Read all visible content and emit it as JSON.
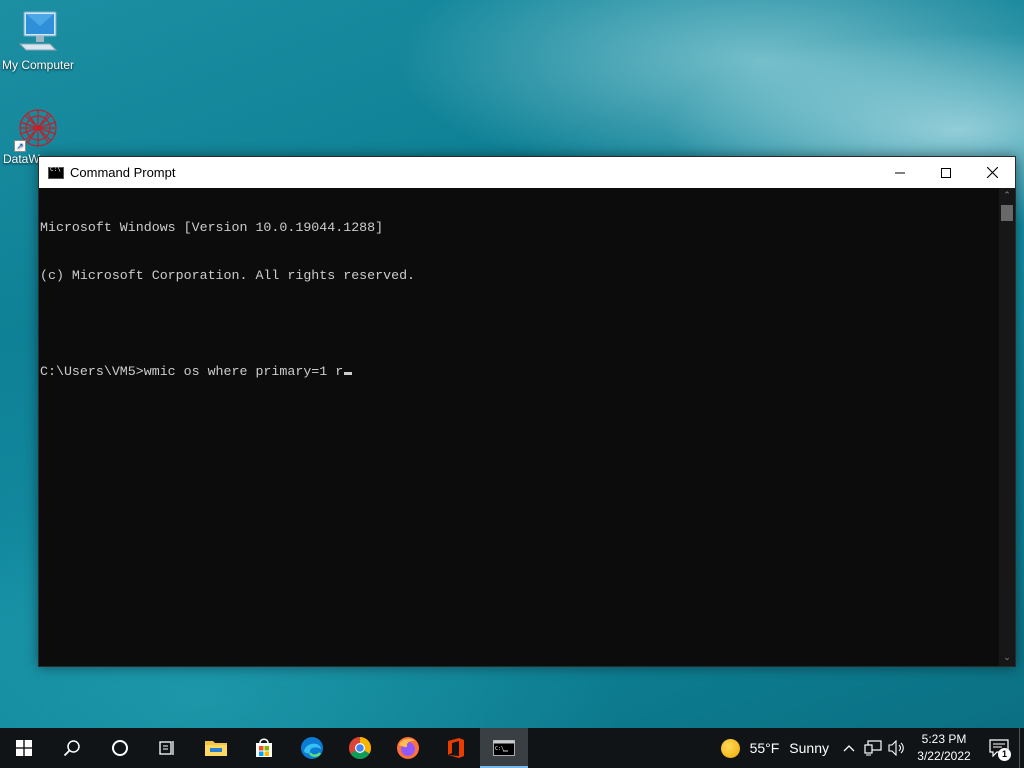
{
  "desktop": {
    "icons": [
      {
        "label": "My Computer",
        "icon": "computer-icon"
      },
      {
        "label": "DataW",
        "icon": "datawatch-icon"
      }
    ]
  },
  "window": {
    "title": "Command Prompt",
    "icon": "cmd-icon",
    "console_lines": [
      "Microsoft Windows [Version 10.0.19044.1288]",
      "(c) Microsoft Corporation. All rights reserved.",
      "",
      "C:\\Users\\VM5>wmic os where primary=1 r"
    ],
    "background_color": "#0c0c0c",
    "text_color": "#cccccc"
  },
  "taskbar": {
    "apps": [
      {
        "name": "start",
        "icon": "windows-logo-icon"
      },
      {
        "name": "search",
        "icon": "search-icon"
      },
      {
        "name": "cortana",
        "icon": "cortana-circle-icon"
      },
      {
        "name": "task-view",
        "icon": "task-view-icon"
      },
      {
        "name": "file-explorer",
        "icon": "folder-icon"
      },
      {
        "name": "microsoft-store",
        "icon": "store-icon"
      },
      {
        "name": "edge",
        "icon": "edge-icon"
      },
      {
        "name": "chrome",
        "icon": "chrome-icon"
      },
      {
        "name": "firefox",
        "icon": "firefox-icon"
      },
      {
        "name": "office",
        "icon": "office-icon"
      },
      {
        "name": "command-prompt",
        "icon": "cmd-icon",
        "active": true
      }
    ],
    "weather": {
      "temp": "55°F",
      "condition": "Sunny",
      "icon": "sun-icon"
    },
    "clock": {
      "time": "5:23 PM",
      "date": "3/22/2022"
    },
    "notifications": {
      "count": "1"
    },
    "accent_color": "#76b9ed"
  }
}
